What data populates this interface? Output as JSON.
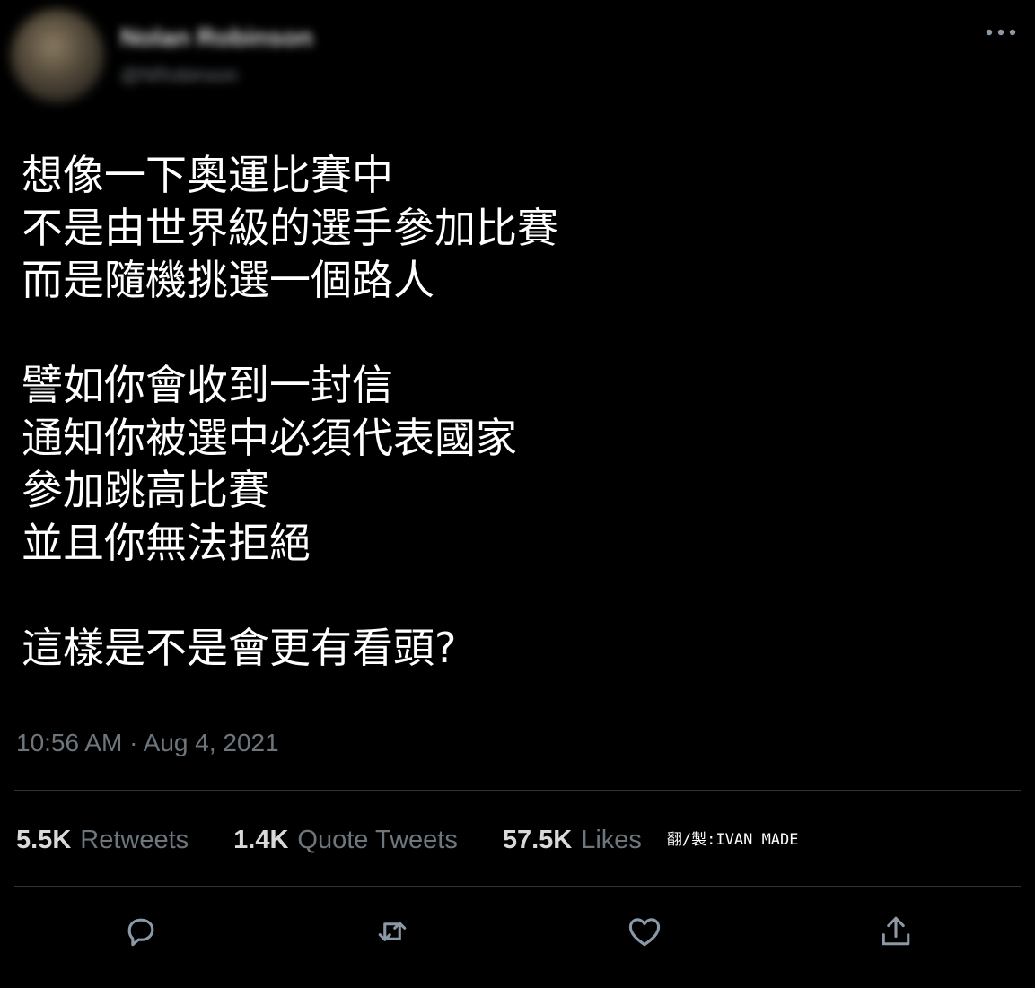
{
  "author": {
    "name": "Nolan Robinson",
    "handle": "@NRobinson"
  },
  "icons": {
    "more": "more-dots-icon",
    "reply": "reply-icon",
    "retweet": "retweet-icon",
    "like": "heart-icon",
    "share": "share-icon"
  },
  "tweet": {
    "lines": [
      "想像一下奧運比賽中",
      "不是由世界級的選手參加比賽",
      "而是隨機挑選一個路人",
      "",
      "譬如你會收到一封信",
      "通知你被選中必須代表國家",
      "參加跳高比賽",
      "並且你無法拒絕",
      "",
      "這樣是不是會更有看頭?"
    ],
    "timestamp": "10:56 AM · Aug 4, 2021"
  },
  "stats": {
    "retweets_count": "5.5K",
    "retweets_label": "Retweets",
    "quotes_count": "1.4K",
    "quotes_label": "Quote Tweets",
    "likes_count": "57.5K",
    "likes_label": "Likes"
  },
  "watermark": "翻/製:IVAN MADE",
  "colors": {
    "background": "#000000",
    "text": "#ffffff",
    "secondary_text": "#6e767d",
    "divider": "#2f3336",
    "icon": "#8b98a5"
  }
}
